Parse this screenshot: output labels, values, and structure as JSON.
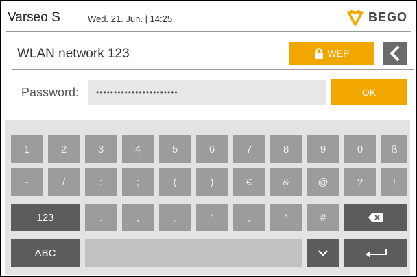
{
  "header": {
    "app_title": "Varseo S",
    "datetime": "Wed. 21. Jun. | 14:25",
    "logo_text": "BEGO"
  },
  "network": {
    "name": "WLAN network 123",
    "security_label": "WEP"
  },
  "password": {
    "label": "Password:",
    "masked_value": "•••••••••••••••••••••••",
    "ok_label": "OK"
  },
  "keyboard": {
    "row1": [
      "1",
      "2",
      "3",
      "4",
      "5",
      "6",
      "7",
      "8",
      "9",
      "0",
      "ß"
    ],
    "row2": [
      "-",
      "/",
      ":",
      ";",
      "(",
      ")",
      "€",
      "&",
      "@",
      "?",
      "!"
    ],
    "row3": [
      "123",
      ".",
      ",",
      "„",
      "“",
      "‚",
      "‘",
      "#"
    ],
    "row4_left": "ABC"
  },
  "colors": {
    "accent": "#f2a700",
    "key": "#9c9c9c",
    "key_dark": "#5c5c5c"
  }
}
